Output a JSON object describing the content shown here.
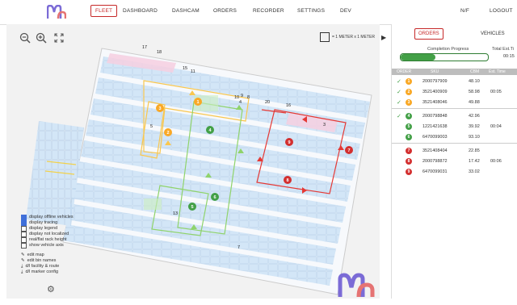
{
  "nav": {
    "items": [
      "FLEET",
      "DASHBOARD",
      "DASHCAM",
      "ORDERS",
      "RECORDER",
      "SETTINGS",
      "DEV"
    ],
    "active": "FLEET",
    "user": "N/F",
    "logout": "LOGOUT"
  },
  "map": {
    "scale_label": "= 1 METER x 1 METER",
    "route_markers": [
      "17",
      "18",
      "15",
      "11",
      "1",
      "3",
      "2",
      "5",
      "20",
      "16",
      "10",
      "9",
      "8",
      "6",
      "4",
      "7",
      "13"
    ],
    "options": [
      {
        "label": "display offline vehicles",
        "checked": true
      },
      {
        "label": "display tracing",
        "checked": true
      },
      {
        "label": "display legend",
        "checked": false
      },
      {
        "label": "display not localized",
        "checked": false
      },
      {
        "label": "real/flat rack height",
        "checked": false
      },
      {
        "label": "show vehicle axis",
        "checked": false
      }
    ],
    "actions": [
      {
        "label": "edit map",
        "icon": "edit-icon"
      },
      {
        "label": "edit bin names",
        "icon": "edit-icon"
      },
      {
        "label": "d/l facility & route",
        "icon": "download-icon"
      },
      {
        "label": "d/l marker config",
        "icon": "download-icon"
      }
    ]
  },
  "panel": {
    "tabs": [
      "ORDERS",
      "VEHICLES"
    ],
    "active_tab": "ORDERS",
    "progress_label": "Completion Progress",
    "progress": 0.4,
    "total_label": "Total Est.Ti",
    "total_value": "00:15",
    "columns": [
      "ORDER",
      "SKU",
      "CBM",
      "Est. Time"
    ],
    "rows": [
      {
        "done": true,
        "order": "1",
        "sku": "2000797909",
        "cbm": "48.10",
        "est": "",
        "color": "#f9a825"
      },
      {
        "done": true,
        "order": "2",
        "sku": "3521400909",
        "cbm": "58.98",
        "est": "00:05",
        "color": "#f9a825"
      },
      {
        "done": true,
        "order": "3",
        "sku": "3521408046",
        "cbm": "49.88",
        "est": "",
        "color": "#f9a825"
      },
      {
        "done": true,
        "order": "4",
        "sku": "2000798848",
        "cbm": "42.96",
        "est": "",
        "color": "#43a047"
      },
      {
        "done": false,
        "order": "5",
        "sku": "1221421638",
        "cbm": "39.92",
        "est": "00:04",
        "color": "#43a047"
      },
      {
        "done": false,
        "order": "6",
        "sku": "6470099003",
        "cbm": "93.10",
        "est": "",
        "color": "#43a047"
      },
      {
        "done": false,
        "order": "7",
        "sku": "3521408404",
        "cbm": "22.85",
        "est": "",
        "color": "#d32f2f"
      },
      {
        "done": false,
        "order": "8",
        "sku": "2000798872",
        "cbm": "17.42",
        "est": "00:06",
        "color": "#d32f2f"
      },
      {
        "done": false,
        "order": "9",
        "sku": "6470099031",
        "cbm": "33.02",
        "est": "",
        "color": "#d32f2f"
      }
    ]
  },
  "colors": {
    "accent": "#c62828",
    "rack": "#cfe3f5",
    "route_yellow": "#f9a825",
    "route_green": "#43a047",
    "route_red": "#d32f2f"
  }
}
